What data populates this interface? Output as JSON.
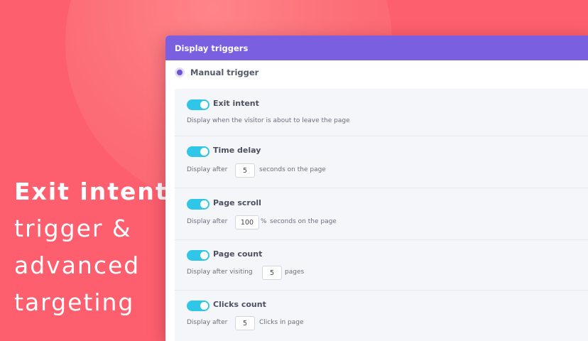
{
  "hero": {
    "line1": "Exit intent",
    "line2": "trigger &",
    "line3": "advanced",
    "line4": "targeting"
  },
  "panel": {
    "title": "Display triggers",
    "manual_trigger": "Manual trigger",
    "triggers": [
      {
        "name": "Exit intent",
        "enabled": true,
        "description": "Display when the visitor is about to leave the page"
      },
      {
        "name": "Time delay",
        "enabled": true,
        "prefix": "Display after",
        "value": "5",
        "suffix": "seconds on the page"
      },
      {
        "name": "Page scroll",
        "enabled": true,
        "prefix": "Display after",
        "value": "100",
        "unit": "%",
        "suffix": "seconds on the page"
      },
      {
        "name": "Page count",
        "enabled": true,
        "prefix": "Display after visiting",
        "value": "5",
        "suffix": "pages"
      },
      {
        "name": "Clicks count",
        "enabled": true,
        "prefix": "Display after",
        "value": "5",
        "suffix": "Clicks in page"
      }
    ]
  },
  "colors": {
    "background": "#fd5f6e",
    "header": "#7a5fe0",
    "toggle_on": "#2fc6e8"
  }
}
